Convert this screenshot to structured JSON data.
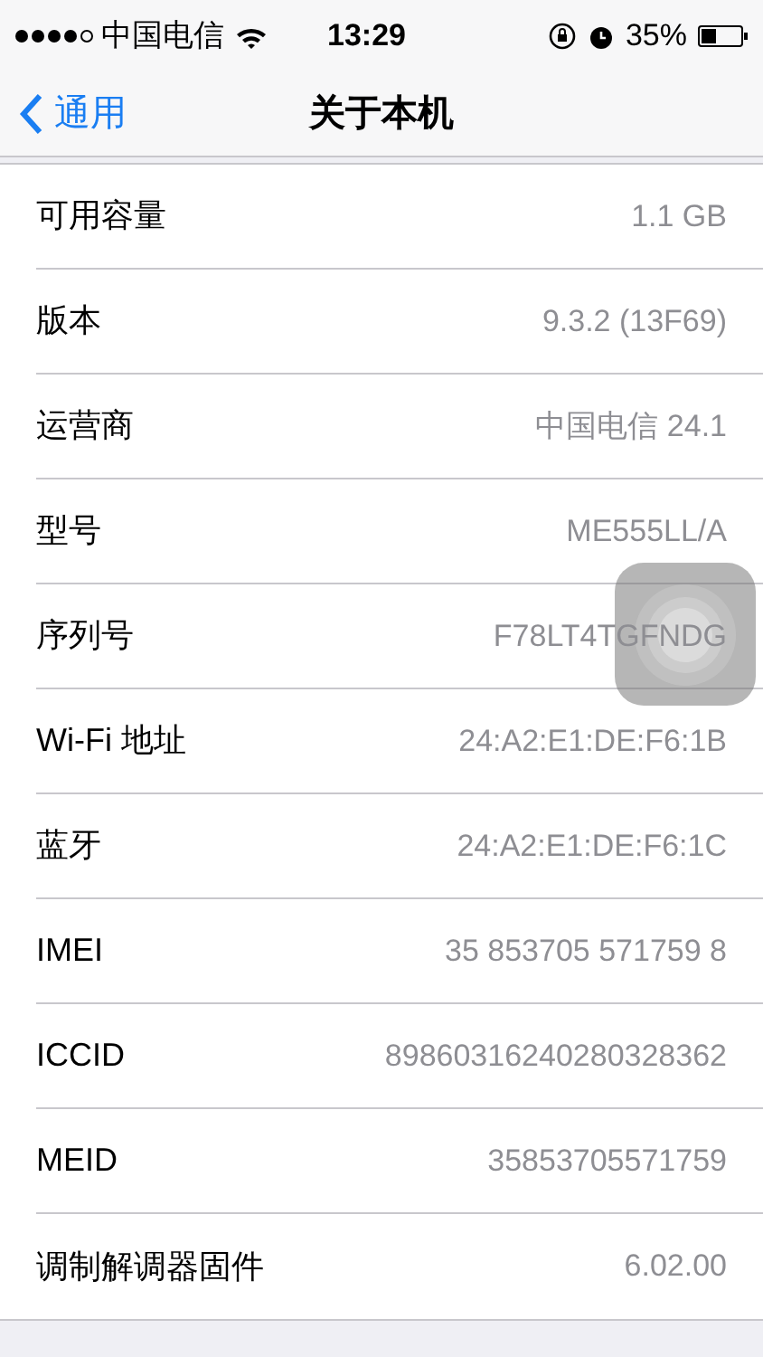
{
  "status_bar": {
    "carrier": "中国电信",
    "time": "13:29",
    "battery": "35%"
  },
  "nav_bar": {
    "back": "通用",
    "title": "关于本机"
  },
  "rows": [
    {
      "label": "可用容量",
      "value": "1.1 GB"
    },
    {
      "label": "版本",
      "value": "9.3.2 (13F69)"
    },
    {
      "label": "运营商",
      "value": "中国电信 24.1"
    },
    {
      "label": "型号",
      "value": "ME555LL/A"
    },
    {
      "label": "序列号",
      "value": "F78LT4TGFNDG"
    },
    {
      "label": "Wi-Fi 地址",
      "value": "24:A2:E1:DE:F6:1B"
    },
    {
      "label": "蓝牙",
      "value": "24:A2:E1:DE:F6:1C"
    },
    {
      "label": "IMEI",
      "value": "35 853705 571759 8"
    },
    {
      "label": "ICCID",
      "value": "89860316240280328362"
    },
    {
      "label": "MEID",
      "value": "35853705571759"
    },
    {
      "label": "调制解调器固件",
      "value": "6.02.00"
    }
  ]
}
